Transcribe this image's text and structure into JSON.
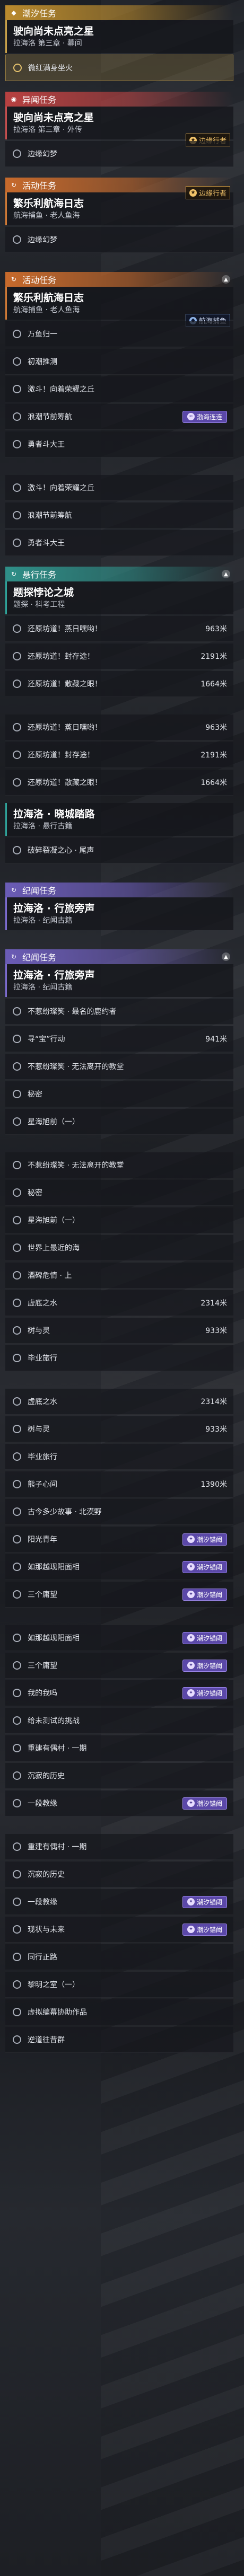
{
  "sections": {
    "s1": {
      "header": "潮汐任务",
      "title": "驶向尚未点亮之星",
      "sub": "拉海洛 第三章 · 幕间",
      "item": "微红满身坐火"
    },
    "s2": {
      "header": "异闻任务",
      "title": "驶向尚未点亮之星",
      "sub": "拉海洛 第三章 · 外传",
      "corner": "边缘行者",
      "item": "边缘幻梦"
    },
    "s3": {
      "header": "活动任务",
      "title": "繁乐利航海日志",
      "sub": "航海捕鱼 · 老人鱼海",
      "corner": "边缘行者",
      "item": "边缘幻梦"
    },
    "s4": {
      "header": "活动任务",
      "title": "繁乐利航海日志",
      "sub": "航海捕鱼 · 老人鱼海",
      "corner_top": "航海捕鱼",
      "corner_bottom": "渤海连连",
      "items": [
        "万鱼归一",
        "初潮推测",
        "激斗！向着荣耀之丘",
        "浪潮节前筹航",
        "勇者斗大王"
      ]
    },
    "s5": {
      "items": [
        "激斗！向着荣耀之丘",
        "浪潮节前筹航",
        "勇者斗大王"
      ]
    },
    "s6": {
      "header": "悬行任务",
      "title": "题探悖论之城",
      "sub": "题探 · 科考工程",
      "items": [
        {
          "text": "还原坊道！蒸日嘿哟！",
          "dist": "963米"
        },
        {
          "text": "还原坊道！封存途！",
          "dist": "2191米"
        },
        {
          "text": "还原坊道！散藏之眼！",
          "dist": "1664米"
        }
      ]
    },
    "s7": {
      "items": [
        {
          "text": "还原坊道！蒸日嘿哟！",
          "dist": "963米"
        },
        {
          "text": "还原坊道！封存途！",
          "dist": "2191米"
        },
        {
          "text": "还原坊道！散藏之眼！",
          "dist": "1664米"
        }
      ]
    },
    "s8": {
      "title": "拉海洛 · 晓城踏路",
      "sub": "拉海洛 · 悬行古籍",
      "item": "破碎裂凝之心 · 尾声"
    },
    "s9": {
      "header": "纪闻任务",
      "title": "拉海洛 · 行旅旁声",
      "sub": "拉海洛 · 纪闻古籍"
    },
    "s10": {
      "header": "纪闻任务",
      "title": "拉海洛 · 行旅旁声",
      "sub": "拉海洛 · 纪闻古籍",
      "items": [
        {
          "text": "不惹纷璨笑 · 最名的鹿约者",
          "dist": ""
        },
        {
          "text": "寻“宝”行动",
          "dist": "941米"
        },
        {
          "text": "不惹纷璨笑 · 无法离开的教堂",
          "dist": ""
        },
        {
          "text": "秘密",
          "dist": ""
        },
        {
          "text": "星海旭前（一）",
          "dist": ""
        }
      ]
    },
    "s11": {
      "items": [
        {
          "text": "不惹纷璨笑 · 无法离开的教堂",
          "dist": "",
          "tag": ""
        },
        {
          "text": "秘密",
          "dist": "",
          "tag": ""
        },
        {
          "text": "星海旭前（一）",
          "dist": "",
          "tag": ""
        },
        {
          "text": "世界上最近的海",
          "dist": "",
          "tag": ""
        },
        {
          "text": "酒碑危情 · 上",
          "dist": "",
          "tag": ""
        },
        {
          "text": "虚底之水",
          "dist": "2314米",
          "tag": ""
        },
        {
          "text": "树与灵",
          "dist": "933米",
          "tag": ""
        },
        {
          "text": "毕业旅行",
          "dist": "",
          "tag": ""
        }
      ]
    },
    "s12": {
      "items": [
        {
          "text": "虚底之水",
          "dist": "2314米",
          "tag": ""
        },
        {
          "text": "树与灵",
          "dist": "933米",
          "tag": ""
        },
        {
          "text": "毕业旅行",
          "dist": "",
          "tag": ""
        },
        {
          "text": "熊子心间",
          "dist": "1390米",
          "tag": ""
        },
        {
          "text": "古今多少故事 · 北漠野",
          "dist": "",
          "tag": ""
        },
        {
          "text": "阳光青年",
          "dist": "",
          "tag": "潮汐锚阈"
        },
        {
          "text": "如那越现阳面相",
          "dist": "",
          "tag": "潮汐锚阈"
        },
        {
          "text": "三个庸望",
          "dist": "",
          "tag": "潮汐锚阈"
        }
      ]
    },
    "s13": {
      "items": [
        {
          "text": "如那越现阳面相",
          "dist": "",
          "tag": "潮汐锚阈"
        },
        {
          "text": "三个庸望",
          "dist": "",
          "tag": "潮汐锚阈"
        },
        {
          "text": "我的我吗",
          "dist": "",
          "tag": "潮汐锚阈"
        },
        {
          "text": "给未测试的挑战",
          "dist": "",
          "tag": ""
        },
        {
          "text": "重建有偶村 · 一期",
          "dist": "",
          "tag": ""
        },
        {
          "text": "沉寂的历史",
          "dist": "",
          "tag": ""
        },
        {
          "text": "一段教缘",
          "dist": "",
          "tag": "潮汐锚阈"
        }
      ]
    },
    "s14": {
      "items": [
        {
          "text": "重建有偶村 · 一期",
          "dist": "",
          "tag": ""
        },
        {
          "text": "沉寂的历史",
          "dist": "",
          "tag": ""
        },
        {
          "text": "一段教缘",
          "dist": "",
          "tag": "潮汐锚阈"
        },
        {
          "text": "现状与未来",
          "dist": "",
          "tag": "潮汐锚阈"
        },
        {
          "text": "同行正路",
          "dist": "",
          "tag": ""
        },
        {
          "text": "黎明之室（一）",
          "dist": "",
          "tag": ""
        },
        {
          "text": "虚拟编幕协助作品",
          "dist": "",
          "tag": ""
        },
        {
          "text": "逆道往昔群",
          "dist": "",
          "tag": ""
        }
      ]
    }
  },
  "colors": {
    "gold": "#c9a24a",
    "red": "#c64f4f",
    "orange": "#d07a36",
    "teal": "#2fa39a",
    "purple": "#7d6cd0"
  }
}
